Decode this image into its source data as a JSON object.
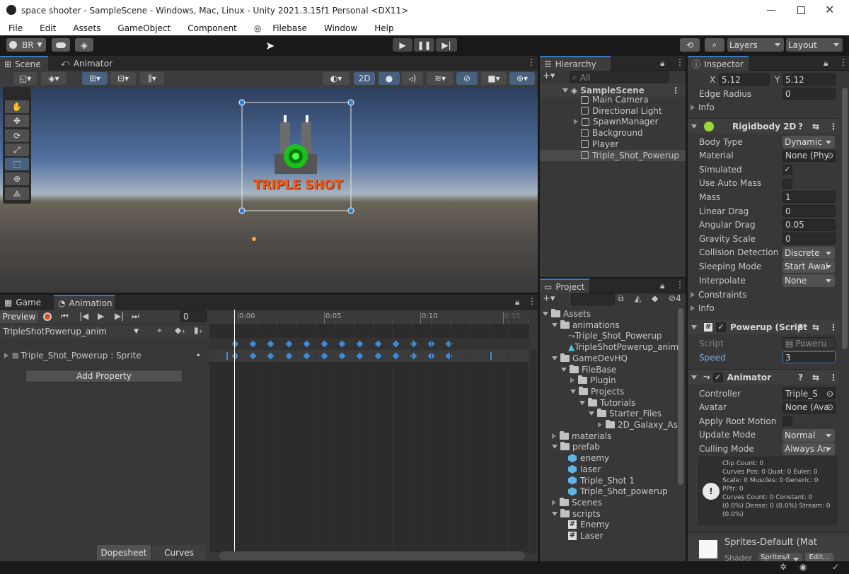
{
  "window": {
    "title": "space shooter - SampleScene - Windows, Mac, Linux - Unity 2021.3.15f1 Personal <DX11>"
  },
  "menu": [
    "File",
    "Edit",
    "Assets",
    "GameObject",
    "Component",
    "Filebase",
    "Window",
    "Help"
  ],
  "toolbar": {
    "account": "BR",
    "layers": "Layers",
    "layout": "Layout"
  },
  "scene": {
    "tab_scene": "Scene",
    "tab_animator": "Animator",
    "mode_2d": "2D",
    "sprite_text": "TRIPLE SHOT"
  },
  "animation": {
    "tab_game": "Game",
    "tab_animation": "Animation",
    "preview": "Preview",
    "frame": "0",
    "clip": "TripleShotPowerup_anim",
    "property": "Triple_Shot_Powerup : Sprite",
    "add_property": "Add Property",
    "dopesheet": "Dopesheet",
    "curves": "Curves",
    "ticks": [
      "0:00",
      "0:05",
      "0:10",
      "0:15"
    ],
    "keyframes": 13
  },
  "hierarchy": {
    "title": "Hierarchy",
    "search": "All",
    "scene": "SampleScene",
    "items": [
      "Main Camera",
      "Directional Light",
      "SpawnManager",
      "Background",
      "Player",
      "Triple_Shot_Powerup"
    ]
  },
  "project": {
    "title": "Project",
    "count": "4",
    "tree": [
      {
        "label": "Assets",
        "depth": 0,
        "kind": "folder",
        "open": true
      },
      {
        "label": "animations",
        "depth": 1,
        "kind": "folder",
        "open": true
      },
      {
        "label": "Triple_Shot_Powerup",
        "depth": 2,
        "kind": "anim"
      },
      {
        "label": "TripleShotPowerup_anim",
        "depth": 2,
        "kind": "clip"
      },
      {
        "label": "GameDevHQ",
        "depth": 1,
        "kind": "folder",
        "open": true
      },
      {
        "label": "FileBase",
        "depth": 2,
        "kind": "folder",
        "open": true
      },
      {
        "label": "Plugin",
        "depth": 3,
        "kind": "folder",
        "open": false
      },
      {
        "label": "Projects",
        "depth": 3,
        "kind": "folder",
        "open": true
      },
      {
        "label": "Tutorials",
        "depth": 4,
        "kind": "folder",
        "open": true
      },
      {
        "label": "Starter_Files",
        "depth": 5,
        "kind": "folder",
        "open": true
      },
      {
        "label": "2D_Galaxy_As",
        "depth": 6,
        "kind": "folder",
        "open": false
      },
      {
        "label": "materials",
        "depth": 1,
        "kind": "folder",
        "open": false
      },
      {
        "label": "prefab",
        "depth": 1,
        "kind": "folder",
        "open": true
      },
      {
        "label": "enemy",
        "depth": 2,
        "kind": "prefab"
      },
      {
        "label": "laser",
        "depth": 2,
        "kind": "prefab"
      },
      {
        "label": "Triple_Shot 1",
        "depth": 2,
        "kind": "prefab"
      },
      {
        "label": "Triple_Shot_powerup",
        "depth": 2,
        "kind": "prefab"
      },
      {
        "label": "Scenes",
        "depth": 1,
        "kind": "folder",
        "open": false
      },
      {
        "label": "scripts",
        "depth": 1,
        "kind": "folder",
        "open": true
      },
      {
        "label": "Enemy",
        "depth": 2,
        "kind": "script"
      },
      {
        "label": "Laser",
        "depth": 2,
        "kind": "script"
      }
    ]
  },
  "inspector": {
    "title": "Inspector",
    "x_label": "X",
    "x_val": "5.12",
    "y_label": "Y",
    "y_val": "5.12",
    "edge_radius_label": "Edge Radius",
    "edge_radius": "0",
    "info": "Info",
    "rigidbody": {
      "title": "Rigidbody 2D",
      "fields": [
        {
          "label": "Body Type",
          "value": "Dynamic",
          "kind": "dd"
        },
        {
          "label": "Material",
          "value": "None (Phy",
          "kind": "obj"
        },
        {
          "label": "Simulated",
          "value": "✓",
          "kind": "chk"
        },
        {
          "label": "Use Auto Mass",
          "value": "",
          "kind": "chk"
        },
        {
          "label": "Mass",
          "value": "1",
          "kind": "field"
        },
        {
          "label": "Linear Drag",
          "value": "0",
          "kind": "field"
        },
        {
          "label": "Angular Drag",
          "value": "0.05",
          "kind": "field"
        },
        {
          "label": "Gravity Scale",
          "value": "0",
          "kind": "field"
        },
        {
          "label": "Collision Detection",
          "value": "Discrete",
          "kind": "dd"
        },
        {
          "label": "Sleeping Mode",
          "value": "Start Awal",
          "kind": "dd"
        },
        {
          "label": "Interpolate",
          "value": "None",
          "kind": "dd"
        }
      ],
      "constraints": "Constraints",
      "info": "Info"
    },
    "powerup": {
      "title": "Powerup (Script",
      "script_label": "Script",
      "script_val": "Poweru",
      "speed_label": "Speed",
      "speed_val": "3"
    },
    "animator": {
      "title": "Animator",
      "fields": [
        {
          "label": "Controller",
          "value": "Triple_S",
          "kind": "obj"
        },
        {
          "label": "Avatar",
          "value": "None (Ava",
          "kind": "obj"
        },
        {
          "label": "Apply Root Motion",
          "value": "",
          "kind": "chk"
        },
        {
          "label": "Update Mode",
          "value": "Normal",
          "kind": "dd"
        },
        {
          "label": "Culling Mode",
          "value": "Always An",
          "kind": "dd"
        }
      ],
      "info_lines": [
        "Clip Count: 0",
        "Curves Pos: 0 Quat: 0 Euler: 0",
        "Scale: 0 Muscles: 0 Generic: 0",
        "PPtr: 0",
        "Curves Count: 0 Constant: 0",
        "(0.0%) Dense: 0 (0.0%) Stream: 0",
        "(0.0%)"
      ]
    },
    "material": {
      "name": "Sprites-Default (Mat",
      "shader": "Shader",
      "shader_val": "Sprites/I",
      "edit": "Edit..."
    }
  }
}
